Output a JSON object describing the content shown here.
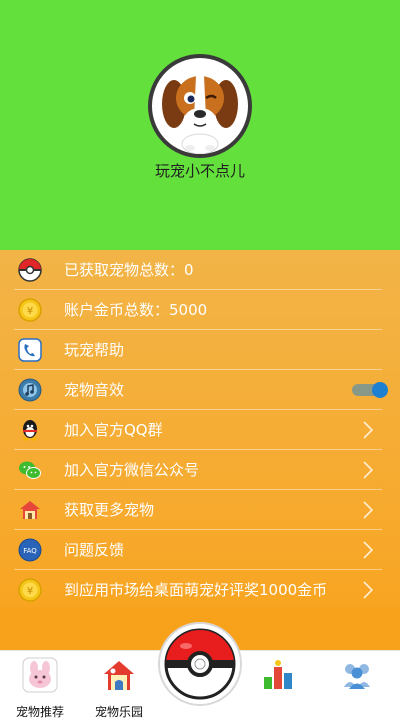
{
  "header": {
    "username": "玩宠小不点儿",
    "bg_color": "#63e03c",
    "avatar_icon": "beagle-puppy-avatar"
  },
  "menu": {
    "items": [
      {
        "label": "已获取宠物总数：0",
        "icon": "pokeball-icon",
        "trailing": "none"
      },
      {
        "label": "账户金币总数：5000",
        "icon": "gold-coin-icon",
        "trailing": "none"
      },
      {
        "label": "玩宠帮助",
        "icon": "help-phone-icon",
        "trailing": "none"
      },
      {
        "label": "宠物音效",
        "icon": "music-note-icon",
        "trailing": "toggle",
        "toggle_on": true
      },
      {
        "label": "加入官方QQ群",
        "icon": "qq-penguin-icon",
        "trailing": "chevron"
      },
      {
        "label": "加入官方微信公众号",
        "icon": "wechat-icon",
        "trailing": "chevron"
      },
      {
        "label": "获取更多宠物",
        "icon": "house-icon",
        "trailing": "chevron"
      },
      {
        "label": "问题反馈",
        "icon": "faq-icon",
        "trailing": "chevron"
      },
      {
        "label": "到应用市场给桌面萌宠好评奖1000金币",
        "icon": "gold-coin-icon",
        "trailing": "chevron"
      }
    ]
  },
  "tabs": [
    {
      "label": "宠物推荐",
      "icon": "pink-pet-icon"
    },
    {
      "label": "宠物乐园",
      "icon": "pet-house-icon"
    },
    {
      "label": "",
      "icon": "pokeball-center-icon"
    },
    {
      "label": "",
      "icon": "ranking-icon"
    },
    {
      "label": "",
      "icon": "community-icon"
    }
  ],
  "colors": {
    "menu_bg": "#f7a92c",
    "toggle_accent": "#1e80d1"
  }
}
